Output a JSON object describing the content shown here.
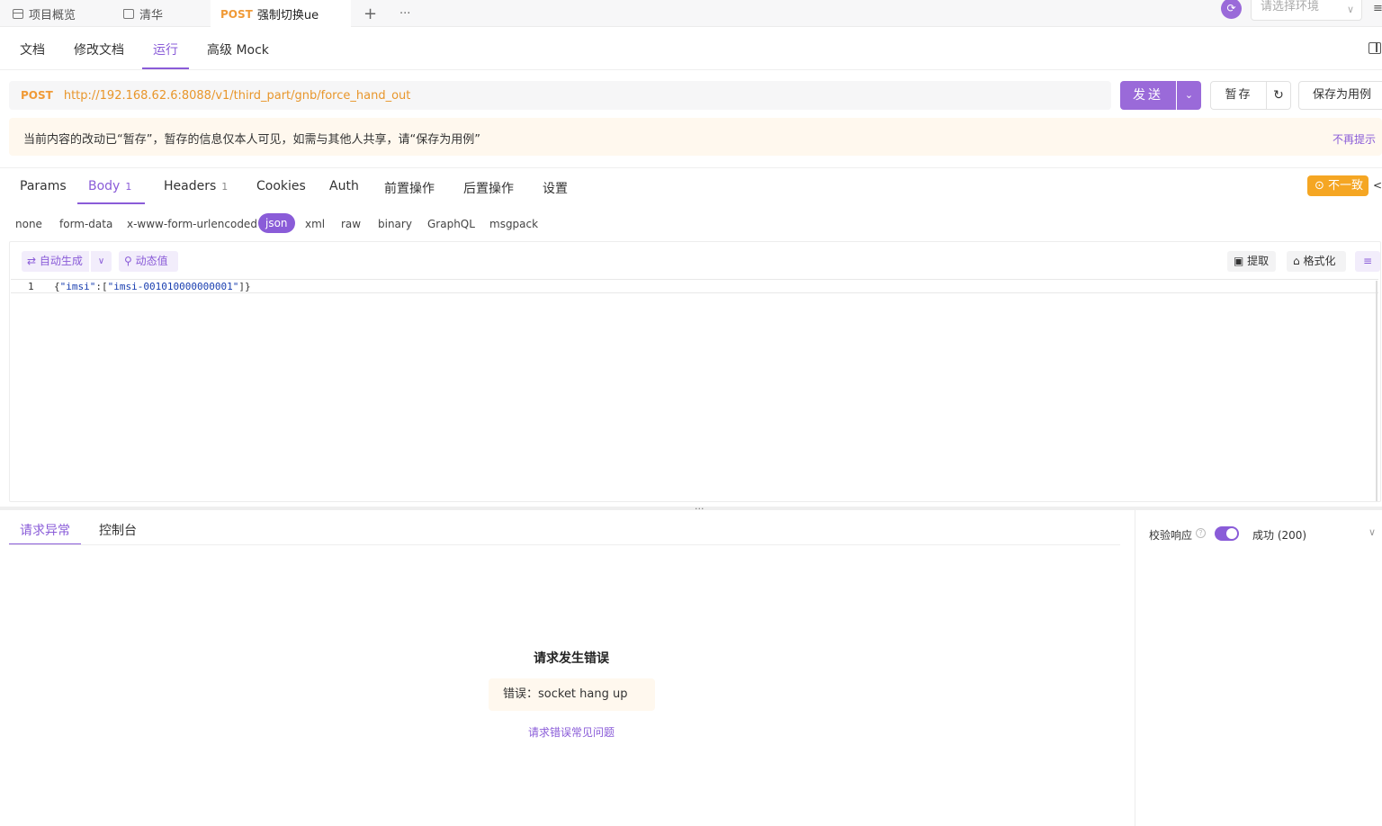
{
  "top_tabs": {
    "overview": "项目概览",
    "folder": "清华",
    "active_method": "POST",
    "active_title": "强制切换ue",
    "add": "+",
    "more": "···"
  },
  "env": {
    "placeholder": "请选择环境"
  },
  "nav": {
    "doc": "文档",
    "edit_doc": "修改文档",
    "run": "运行",
    "mock": "高级 Mock"
  },
  "request": {
    "method": "POST",
    "url": "http://192.168.62.6:8088/v1/third_part/gnb/force_hand_out",
    "send": "发送",
    "stash": "暂存",
    "save_case": "保存为用例"
  },
  "notice": {
    "text": "当前内容的改动已“暂存”，暂存的信息仅本人可见，如需与其他人共享，请“保存为用例”",
    "dismiss": "不再提示"
  },
  "req_tabs": {
    "params": "Params",
    "body": "Body",
    "body_count": "1",
    "headers": "Headers",
    "headers_count": "1",
    "cookies": "Cookies",
    "auth": "Auth",
    "pre": "前置操作",
    "post": "后置操作",
    "settings": "设置",
    "inconsistent": "不一致",
    "code": "</"
  },
  "body_types": {
    "none": "none",
    "form_data": "form-data",
    "urlencoded": "x-www-form-urlencoded",
    "json": "json",
    "xml": "xml",
    "raw": "raw",
    "binary": "binary",
    "graphql": "GraphQL",
    "msgpack": "msgpack"
  },
  "editor": {
    "auto_generate": "自动生成",
    "dynamic_value": "动态值",
    "extract": "提取",
    "format": "格式化",
    "line_number": "1",
    "code_open": "{",
    "code_key": "\"imsi\"",
    "code_mid": ":[",
    "code_val": "\"imsi-001010000000001\"",
    "code_close": "]}"
  },
  "response": {
    "tab_error": "请求异常",
    "tab_console": "控制台",
    "verify_label": "校验响应",
    "status": "成功 (200)",
    "error_title": "请求发生错误",
    "error_msg": "错误：socket hang up",
    "error_link": "请求错误常见问题"
  },
  "colors": {
    "accent": "#8a5cd8",
    "post": "#f09a37",
    "warn": "#f5a623"
  }
}
